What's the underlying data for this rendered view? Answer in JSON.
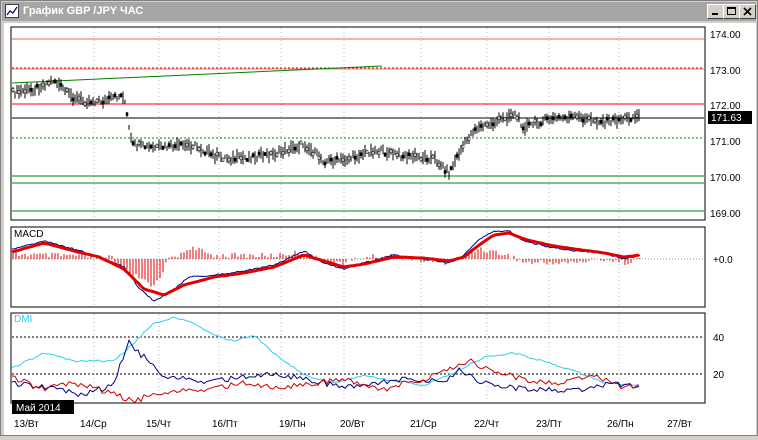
{
  "window": {
    "title": "График GBP /JPY  ЧАС",
    "minimize_label": "_",
    "maximize_label": "□",
    "close_label": "×"
  },
  "main_panel": {
    "price_labels": [
      "174.00",
      "173.00",
      "172.00",
      "171.00",
      "170.00",
      "169.00"
    ],
    "current_price": "171.63"
  },
  "macd_panel": {
    "label": "MACD",
    "zero_label": "+0.0"
  },
  "dmi_panel": {
    "label": "DMI",
    "levels": [
      "40",
      "20"
    ]
  },
  "x_axis": {
    "period_label": "Май 2014",
    "dates": [
      "13/Вт",
      "14/Ср",
      "15/Чт",
      "16/Пт",
      "19/Пн",
      "20/Вт",
      "21/Ср",
      "22/Чт",
      "23/Пт",
      "26/Пн",
      "27/Вт"
    ]
  },
  "colors": {
    "bull_bear_resistance": "#ff0000",
    "support": "#008000",
    "macd_signal": "#e00000",
    "dmi_adx": "#33ccee",
    "dmi_plus": "#000080",
    "dmi_minus": "#cc0000"
  }
}
